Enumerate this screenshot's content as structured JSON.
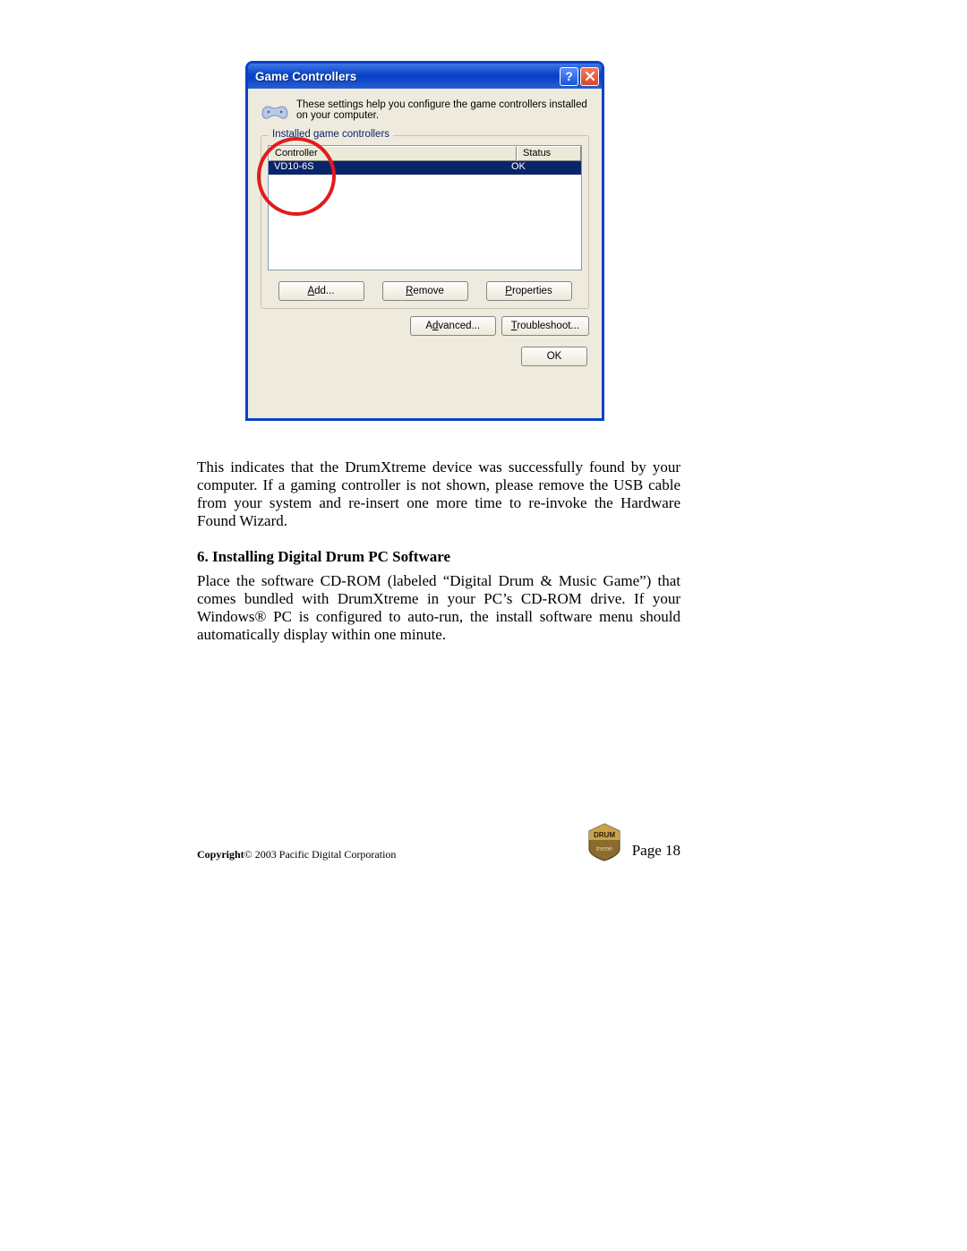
{
  "dialog": {
    "title": "Game Controllers",
    "intro": "These settings help you configure the game controllers installed on your computer.",
    "fieldset_legend": "Installed game controllers",
    "columns": {
      "controller": "Controller",
      "status": "Status"
    },
    "row": {
      "name": "VD10-6S",
      "status": "OK"
    },
    "buttons": {
      "add": "Add...",
      "remove": "Remove",
      "properties": "Properties",
      "advanced": "Advanced...",
      "troubleshoot": "Troubleshoot...",
      "ok": "OK"
    }
  },
  "doc": {
    "para1": "This indicates that the DrumXtreme device was successfully found by your computer.   If a gaming controller is not shown, please remove the USB cable from your system and re-insert one more time to re-invoke the Hardware Found Wizard.",
    "heading": "6.   Installing Digital Drum PC Software",
    "para2": "Place the software CD-ROM (labeled “Digital Drum & Music Game”) that comes bundled with DrumXtreme in your PC’s CD-ROM drive.  If your Windows® PC is configured to auto-run, the install software menu should automatically display within one minute.",
    "copyright_bold": "Copyright",
    "copyright_rest": "© 2003 Pacific Digital Corporation",
    "pageno": "Page 18"
  }
}
